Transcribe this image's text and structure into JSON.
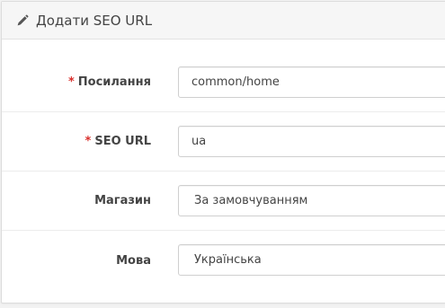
{
  "panel": {
    "title": "Додати SEO URL",
    "icon": "pencil-icon"
  },
  "form": {
    "fields": [
      {
        "label": "Посилання",
        "required": "*",
        "value": "common/home",
        "type": "text"
      },
      {
        "label": "SEO URL",
        "required": "*",
        "value": "ua",
        "type": "text"
      },
      {
        "label": "Магазин",
        "value": "За замовчуванням",
        "type": "select"
      },
      {
        "label": "Мова",
        "value": "Українська",
        "type": "select"
      }
    ]
  },
  "colors": {
    "required": "#d9302c",
    "heading_bg": "#f6f6f6",
    "border": "#cfcfcf"
  }
}
